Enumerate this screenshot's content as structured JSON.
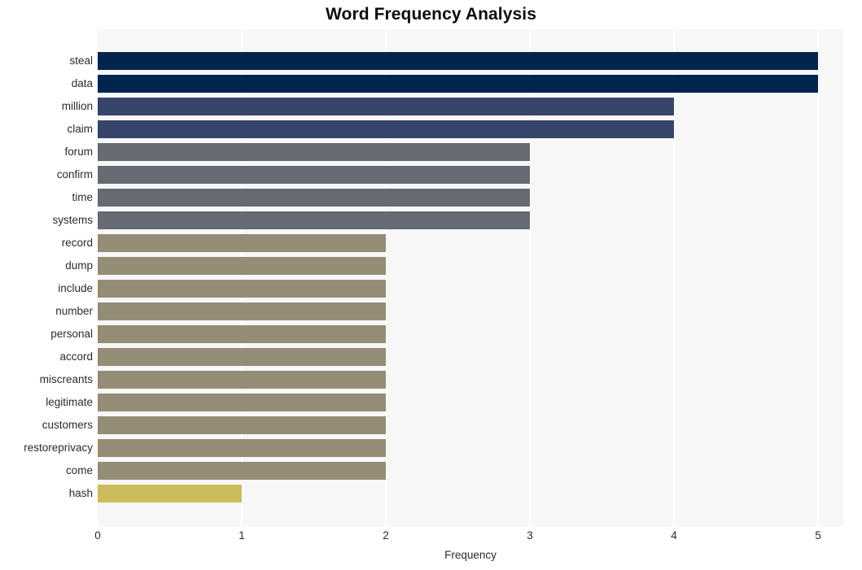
{
  "chart_data": {
    "type": "bar",
    "orientation": "horizontal",
    "title": "Word Frequency Analysis",
    "xlabel": "Frequency",
    "ylabel": "",
    "xlim": [
      0,
      5.2
    ],
    "xticks": [
      0,
      1,
      2,
      3,
      4,
      5
    ],
    "xtick_labels": [
      "0",
      "1",
      "2",
      "3",
      "4",
      "5"
    ],
    "grid": "vertical-white-gridlines",
    "legend": "none",
    "plot_background": "#f7f7f7",
    "categories": [
      "steal",
      "data",
      "million",
      "claim",
      "forum",
      "confirm",
      "time",
      "systems",
      "record",
      "dump",
      "include",
      "number",
      "personal",
      "accord",
      "miscreants",
      "legitimate",
      "customers",
      "restoreprivacy",
      "come",
      "hash"
    ],
    "values": [
      5,
      5,
      4,
      4,
      3,
      3,
      3,
      3,
      2,
      2,
      2,
      2,
      2,
      2,
      2,
      2,
      2,
      2,
      2,
      1
    ],
    "bar_colors": [
      "#022550",
      "#022550",
      "#38456b",
      "#38456b",
      "#666a72",
      "#666a72",
      "#666a72",
      "#666a72",
      "#948c75",
      "#948c75",
      "#948c75",
      "#948c75",
      "#948c75",
      "#948c75",
      "#948c75",
      "#948c75",
      "#948c75",
      "#948c75",
      "#948c75",
      "#cdbc5d"
    ],
    "colors": {
      "value_5": "#022550",
      "value_4": "#38456b",
      "value_3": "#666a72",
      "value_2": "#948c75",
      "value_1": "#cdbc5d",
      "title": "#0d0d0d",
      "tick_text": "#2b2b2b",
      "grid": "#ffffff",
      "figure_background": "#ffffff"
    }
  }
}
